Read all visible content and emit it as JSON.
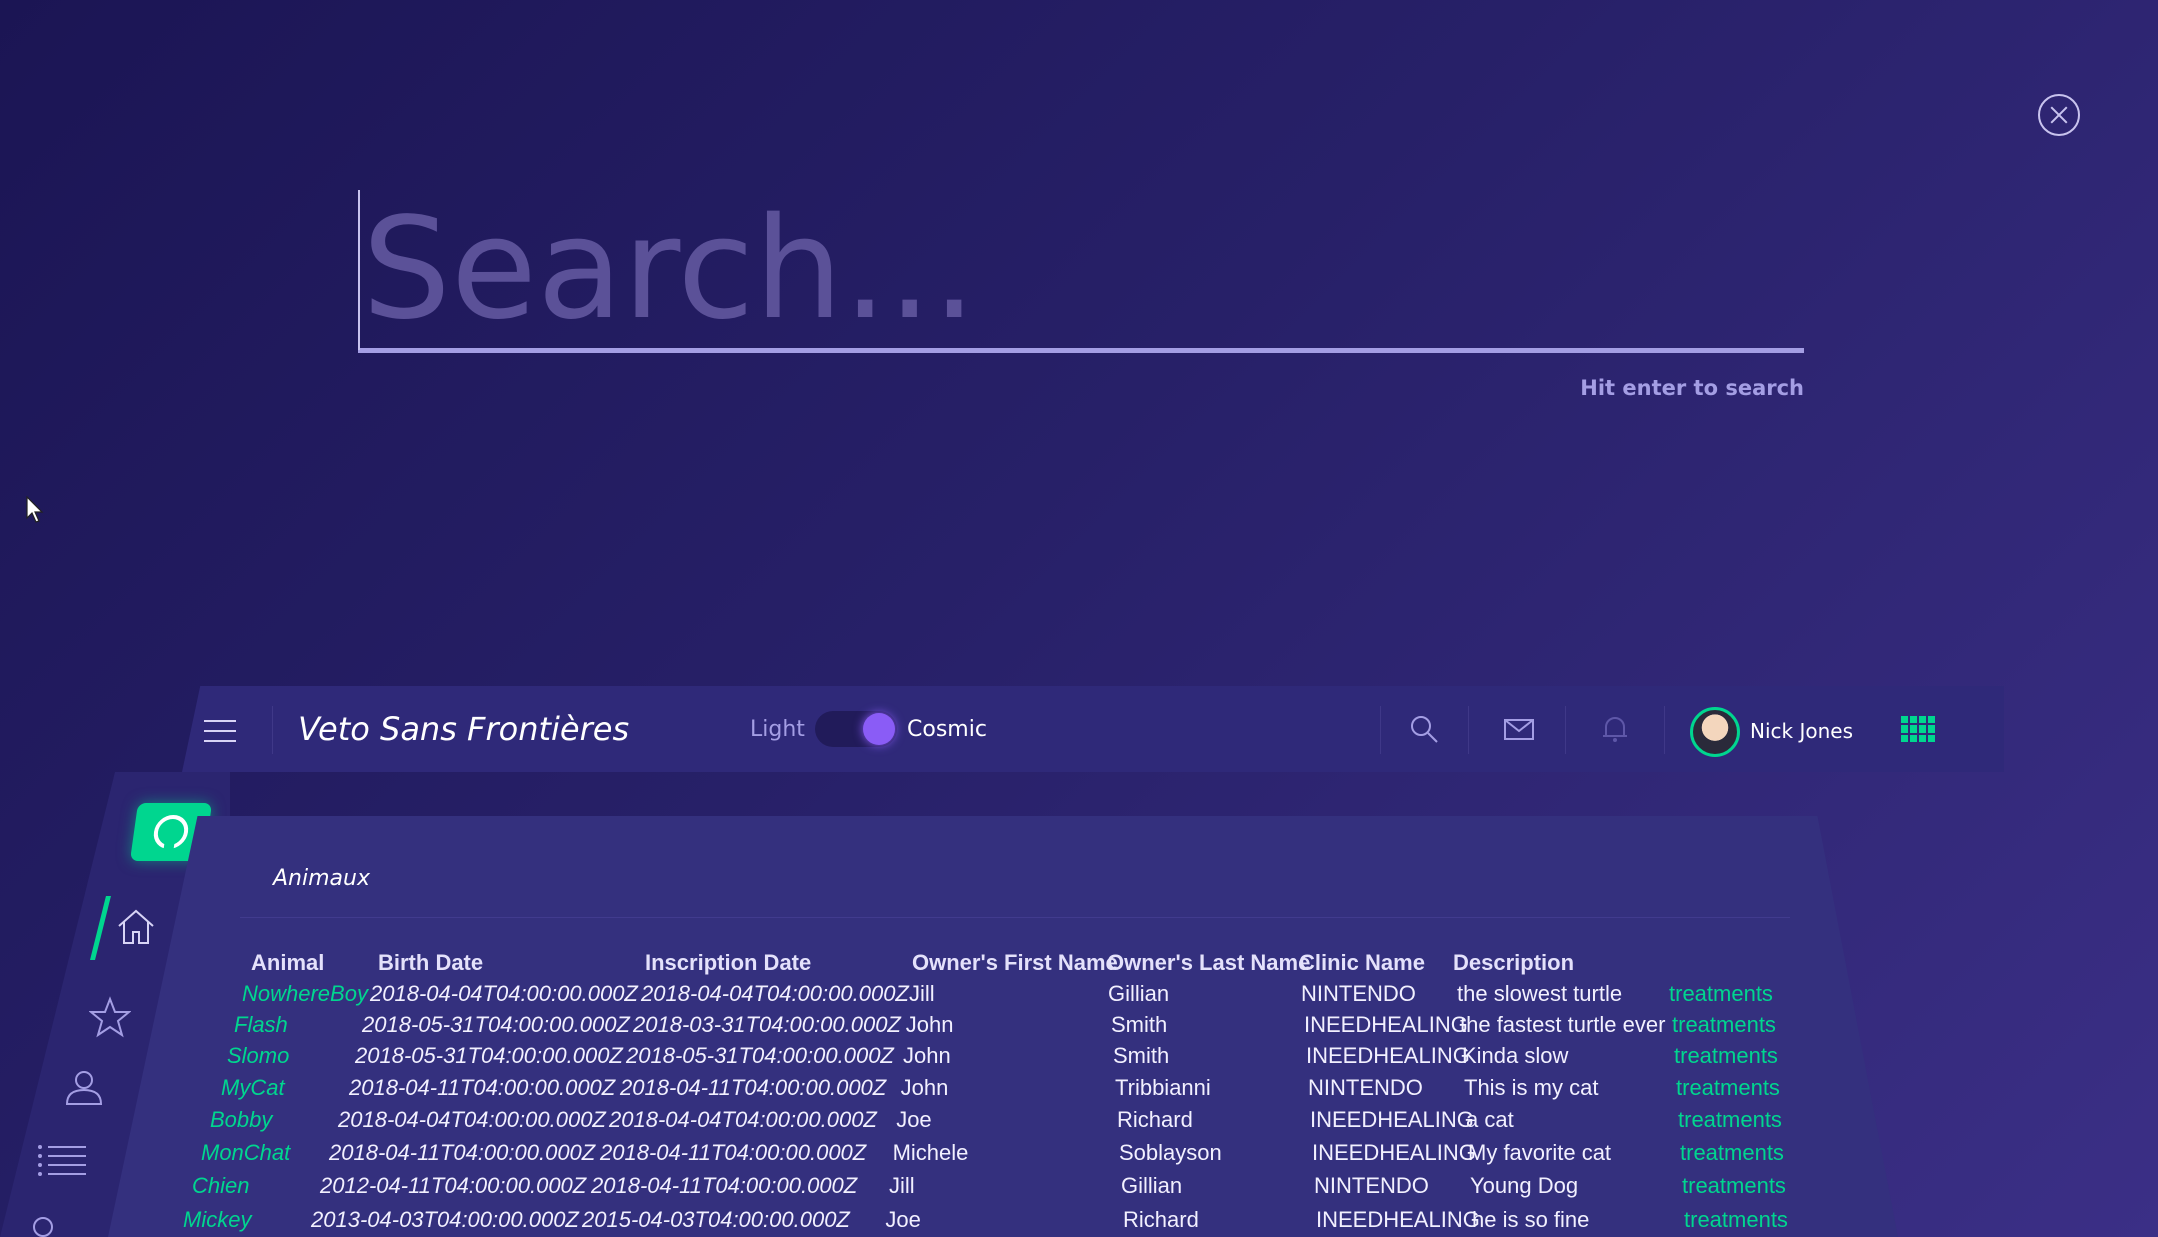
{
  "search": {
    "placeholder": "Search...",
    "hint": "Hit enter to search"
  },
  "navbar": {
    "title": "Veto Sans Frontières",
    "theme_left": "Light",
    "theme_right": "Cosmic",
    "user_name": "Nick Jones"
  },
  "card": {
    "title": "Animaux",
    "headers": [
      "Animal",
      "Birth Date",
      "Inscription Date",
      "Owner's First Name",
      "Owner's Last Name",
      "Clinic Name",
      "Description"
    ],
    "rows": [
      {
        "animal": "NowhereBoy",
        "birth": "2018-04-04T04:00:00.000Z",
        "inscription": "2018-04-04T04:00:00.000Z",
        "first": "Jill",
        "last": "Gillian",
        "clinic": "NINTENDO",
        "desc": "the slowest turtle",
        "link": "treatments"
      },
      {
        "animal": "Flash",
        "birth": "2018-05-31T04:00:00.000Z",
        "inscription": "2018-03-31T04:00:00.000Z",
        "first": "John",
        "last": "Smith",
        "clinic": "INEEDHEALING",
        "desc": "the fastest turtle ever",
        "link": "treatments"
      },
      {
        "animal": "Slomo",
        "birth": "2018-05-31T04:00:00.000Z",
        "inscription": "2018-05-31T04:00:00.000Z",
        "first": "John",
        "last": "Smith",
        "clinic": "INEEDHEALING",
        "desc": "Kinda slow",
        "link": "treatments"
      },
      {
        "animal": "MyCat",
        "birth": "2018-04-11T04:00:00.000Z",
        "inscription": "2018-04-11T04:00:00.000Z",
        "first": "John",
        "last": "Tribbianni",
        "clinic": "NINTENDO",
        "desc": "This is my cat",
        "link": "treatments"
      },
      {
        "animal": "Bobby",
        "birth": "2018-04-04T04:00:00.000Z",
        "inscription": "2018-04-04T04:00:00.000Z",
        "first": "Joe",
        "last": "Richard",
        "clinic": "INEEDHEALING",
        "desc": "a cat",
        "link": "treatments"
      },
      {
        "animal": "MonChat",
        "birth": "2018-04-11T04:00:00.000Z",
        "inscription": "2018-04-11T04:00:00.000Z",
        "first": "Michele",
        "last": "Soblayson",
        "clinic": "INEEDHEALING",
        "desc": "My favorite cat",
        "link": "treatments"
      },
      {
        "animal": "Chien",
        "birth": "2012-04-11T04:00:00.000Z",
        "inscription": "2018-04-11T04:00:00.000Z",
        "first": "Jill",
        "last": "Gillian",
        "clinic": "NINTENDO",
        "desc": "Young Dog",
        "link": "treatments"
      },
      {
        "animal": "Mickey",
        "birth": "2013-04-03T04:00:00.000Z",
        "inscription": "2015-04-03T04:00:00.000Z",
        "first": "Joe",
        "last": "Richard",
        "clinic": "INEEDHEALING",
        "desc": "he is so fine",
        "link": "treatments"
      }
    ]
  },
  "icons": {
    "close": "close-icon",
    "menu": "hamburger-menu-icon",
    "search": "search-icon",
    "mail": "mail-icon",
    "bell": "bell-icon",
    "apps": "grid-icon",
    "github": "github-icon",
    "home": "home-icon",
    "star": "star-icon",
    "user": "user-icon",
    "list": "list-icon"
  },
  "colors": {
    "accent": "#00d68f",
    "toggle_knob": "#8a5cf6",
    "background": "#272068"
  }
}
